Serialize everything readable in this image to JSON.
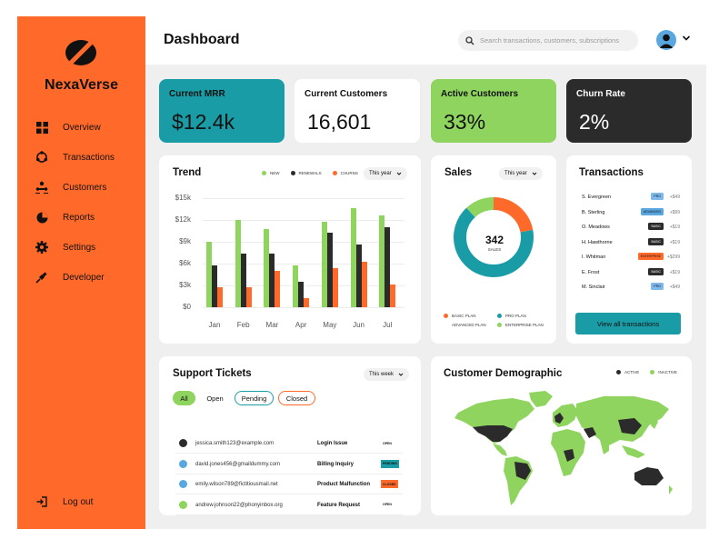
{
  "sidebar": {
    "brand": "NexaVerse",
    "items": [
      {
        "label": "Overview",
        "icon": "grid-icon"
      },
      {
        "label": "Transactions",
        "icon": "cycle-icon"
      },
      {
        "label": "Customers",
        "icon": "users-icon"
      },
      {
        "label": "Reports",
        "icon": "pie-icon"
      },
      {
        "label": "Settings",
        "icon": "gear-icon"
      },
      {
        "label": "Developer",
        "icon": "plug-icon"
      }
    ],
    "logout": "Log out"
  },
  "header": {
    "title": "Dashboard",
    "search_placeholder": "Search transactions, customers, subscriptions"
  },
  "stats": [
    {
      "label": "Current MRR",
      "value": "$12.4k",
      "bg": "#1a9ca6",
      "fg": "#111111"
    },
    {
      "label": "Current Customers",
      "value": "16,601",
      "bg": "#ffffff",
      "fg": "#111111"
    },
    {
      "label": "Active Customers",
      "value": "33%",
      "bg": "#8ed45f",
      "fg": "#111111"
    },
    {
      "label": "Churn Rate",
      "value": "2%",
      "bg": "#2b2b2b",
      "fg": "#ffffff"
    }
  ],
  "trend": {
    "title": "Trend",
    "period": "This year",
    "legend": [
      "NEW",
      "RENEWALS",
      "CHURNS"
    ]
  },
  "chart_data": {
    "type": "bar",
    "categories": [
      "Jan",
      "Feb",
      "Mar",
      "Apr",
      "May",
      "Jun",
      "Jul"
    ],
    "series": [
      {
        "name": "NEW",
        "color": "#8ed45f",
        "values": [
          9000,
          12000,
          10700,
          5800,
          11700,
          13600,
          12600
        ]
      },
      {
        "name": "RENEWALS",
        "color": "#2b2b2b",
        "values": [
          5700,
          7400,
          7400,
          3500,
          10300,
          8600,
          11000
        ]
      },
      {
        "name": "CHURNS",
        "color": "#ff6a2b",
        "values": [
          2700,
          2800,
          5000,
          1300,
          5400,
          6300,
          3100
        ]
      }
    ],
    "yticks": [
      "$15k",
      "$12k",
      "$9k",
      "$6k",
      "$3k",
      "$0"
    ],
    "ylim": [
      0,
      15000
    ]
  },
  "sales": {
    "title": "Sales",
    "period": "This year",
    "center_value": "342",
    "center_label": "SALES",
    "legend": [
      {
        "label": "BASIC PLAN",
        "color": "#ff6a2b"
      },
      {
        "label": "PRO PLAN",
        "color": "#1a9ca6"
      },
      {
        "label": "ADVANCED PLAN",
        "color": "#e8e8e8"
      },
      {
        "label": "ENTERPRISE PLAN",
        "color": "#8ed45f"
      }
    ],
    "segments": [
      {
        "label": "BASIC PLAN",
        "fraction": 0.22,
        "color": "#ff6a2b"
      },
      {
        "label": "PRO PLAN",
        "fraction": 0.66,
        "color": "#1a9ca6"
      },
      {
        "label": "ENTERPRISE PLAN",
        "fraction": 0.12,
        "color": "#8ed45f"
      }
    ]
  },
  "transactions": {
    "title": "Transactions",
    "rows": [
      {
        "name": "S. Evergreen",
        "plan": "PRO",
        "color": "#7fb8ea",
        "amount": "+$49"
      },
      {
        "name": "B. Sterling",
        "plan": "ADVANCED",
        "color": "#5aa7e0",
        "amount": "+$99"
      },
      {
        "name": "O. Meadows",
        "plan": "BASIC",
        "color": "#2b2b2b",
        "amount": "+$19"
      },
      {
        "name": "H. Hawthorne",
        "plan": "BASIC",
        "color": "#2b2b2b",
        "amount": "+$19"
      },
      {
        "name": "I. Whitman",
        "plan": "ENTERPRISE",
        "color": "#ff6a2b",
        "amount": "+$299"
      },
      {
        "name": "E. Frost",
        "plan": "BASIC",
        "color": "#2b2b2b",
        "amount": "+$19"
      },
      {
        "name": "M. Sinclair",
        "plan": "PRO",
        "color": "#7fb8ea",
        "amount": "+$49"
      }
    ],
    "button": "View all transactions"
  },
  "tickets": {
    "title": "Support Tickets",
    "period": "This week",
    "tabs": [
      "All",
      "Open",
      "Pending",
      "Closed"
    ],
    "rows": [
      {
        "email": "jessica.smith123@example.com",
        "issue": "Login Issue",
        "status": "OPEN",
        "dot": "#2b2b2b",
        "badge": "#ffffff"
      },
      {
        "email": "david.jones456@gmaildummy.com",
        "issue": "Billing Inquiry",
        "status": "PENDING",
        "dot": "#5aa7e0",
        "badge": "#1a9ca6"
      },
      {
        "email": "emily.wilson789@fictitiousmail.net",
        "issue": "Product Malfunction",
        "status": "CLOSED",
        "dot": "#5aa7e0",
        "badge": "#ff6a2b"
      },
      {
        "email": "andrew.johnson22@phonyinbox.org",
        "issue": "Feature Request",
        "status": "OPEN",
        "dot": "#8ed45f",
        "badge": "#ffffff"
      }
    ]
  },
  "demographic": {
    "title": "Customer Demographic",
    "legend": [
      {
        "label": "ACTIVE",
        "color": "#2b2b2b"
      },
      {
        "label": "INACTIVE",
        "color": "#8ed45f"
      }
    ]
  }
}
